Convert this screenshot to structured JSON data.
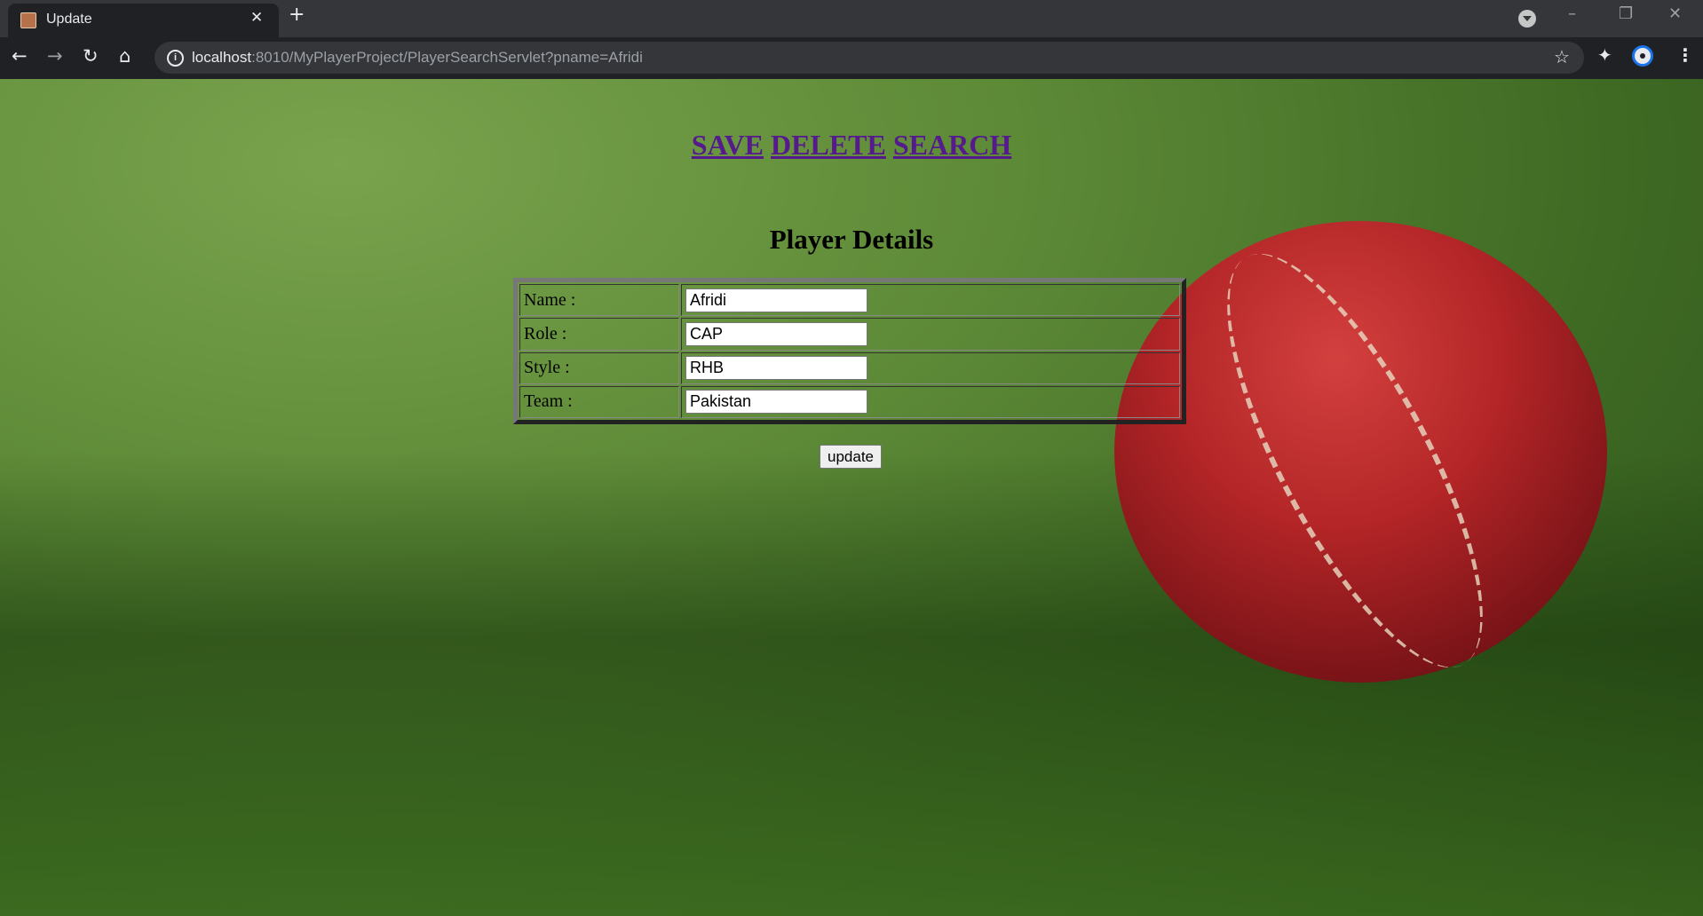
{
  "browser": {
    "tab_title": "Update",
    "tab_close_icon": "close-icon",
    "new_tab_icon": "plus-icon",
    "url_host": "localhost",
    "url_rest": ":8010/MyPlayerProject/PlayerSearchServlet?pname=Afridi",
    "accent": "#1a73e8"
  },
  "nav": {
    "save": "SAVE",
    "delete": "DELETE",
    "search": "SEARCH"
  },
  "form": {
    "title": "Player Details",
    "rows": [
      {
        "label": "Name :",
        "value": "Afridi"
      },
      {
        "label": "Role :",
        "value": "CAP"
      },
      {
        "label": "Style :",
        "value": "RHB"
      },
      {
        "label": "Team :",
        "value": "Pakistan"
      }
    ],
    "submit": "update"
  }
}
